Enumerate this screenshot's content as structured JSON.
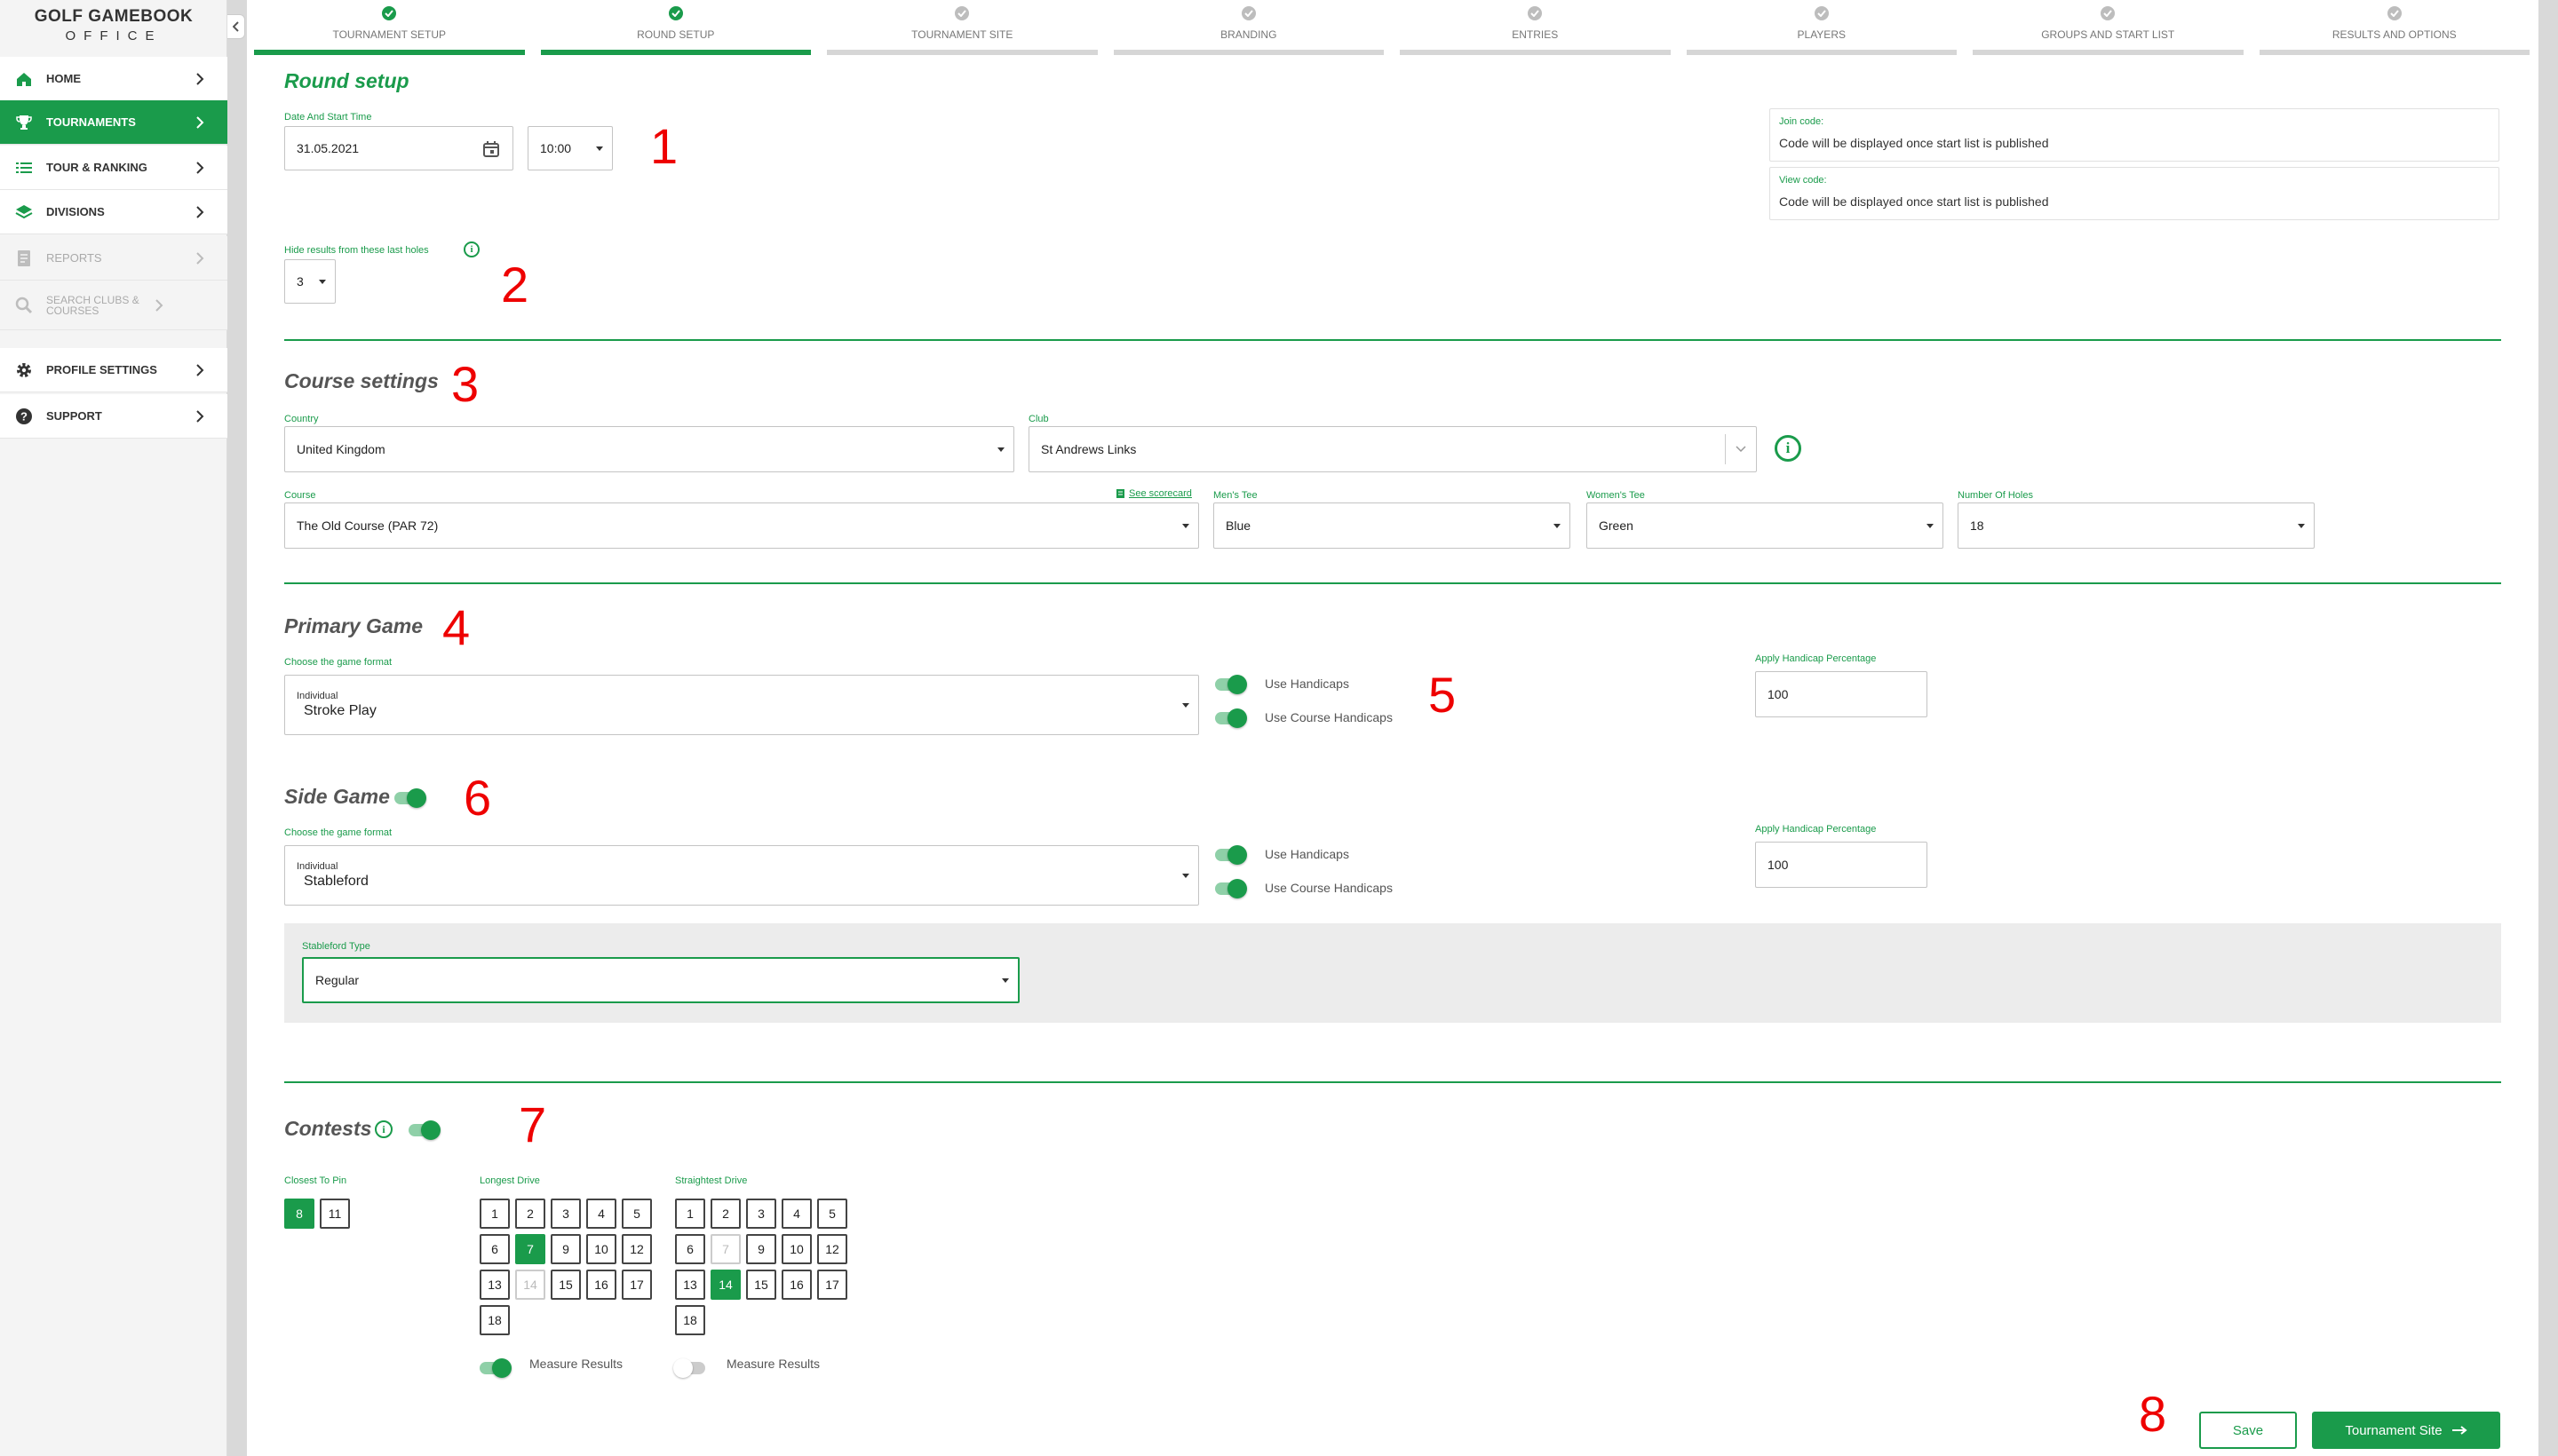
{
  "brand": {
    "logo_top": "GOLF GAMEBOOK",
    "logo_bottom": "OFFICE",
    "accent": "#1a9b4b"
  },
  "sidebar": {
    "items": [
      {
        "label": "HOME",
        "icon": "home-icon",
        "state": "normal"
      },
      {
        "label": "TOURNAMENTS",
        "icon": "trophy-icon",
        "state": "active"
      },
      {
        "label": "TOUR & RANKING",
        "icon": "list-icon",
        "state": "normal"
      },
      {
        "label": "DIVISIONS",
        "icon": "layers-icon",
        "state": "normal"
      },
      {
        "label": "REPORTS",
        "icon": "report-icon",
        "state": "disabled"
      },
      {
        "label": "SEARCH CLUBS & COURSES",
        "icon": "search-icon",
        "state": "disabled"
      },
      {
        "label": "PROFILE SETTINGS",
        "icon": "gear-icon",
        "state": "normal"
      },
      {
        "label": "SUPPORT",
        "icon": "help-icon",
        "state": "normal"
      }
    ]
  },
  "stepper": [
    {
      "label": "TOURNAMENT SETUP",
      "state": "done"
    },
    {
      "label": "ROUND SETUP",
      "state": "done"
    },
    {
      "label": "TOURNAMENT SITE",
      "state": "todo"
    },
    {
      "label": "BRANDING",
      "state": "todo"
    },
    {
      "label": "ENTRIES",
      "state": "todo"
    },
    {
      "label": "PLAYERS",
      "state": "todo"
    },
    {
      "label": "GROUPS AND START LIST",
      "state": "todo"
    },
    {
      "label": "RESULTS AND OPTIONS",
      "state": "todo"
    }
  ],
  "round": {
    "title": "Round setup",
    "date_label": "Date And Start Time",
    "date": "31.05.2021",
    "time": "10:00",
    "join_label": "Join code:",
    "join_value": "Code will be displayed once start list is published",
    "view_label": "View code:",
    "view_value": "Code will be displayed once start list is published",
    "hide_label": "Hide results from these last holes",
    "hide_value": "3"
  },
  "course": {
    "title": "Course settings",
    "country_label": "Country",
    "country": "United Kingdom",
    "club_label": "Club",
    "club": "St Andrews Links",
    "course_label": "Course",
    "course": "The Old Course (PAR 72)",
    "scorecard": "See scorecard",
    "mens_label": "Men's Tee",
    "mens": "Blue",
    "womens_label": "Women's Tee",
    "womens": "Green",
    "holes_label": "Number Of Holes",
    "holes": "18"
  },
  "primary": {
    "title": "Primary Game",
    "format_label": "Choose the game format",
    "format_type": "Individual",
    "format": "Stroke Play",
    "use_hcp": "Use Handicaps",
    "use_course_hcp": "Use Course Handicaps",
    "pct_label": "Apply Handicap Percentage",
    "pct": "100"
  },
  "side": {
    "title": "Side Game",
    "enabled": true,
    "format_label": "Choose the game format",
    "format_type": "Individual",
    "format": "Stableford",
    "use_hcp": "Use Handicaps",
    "use_course_hcp": "Use Course Handicaps",
    "pct_label": "Apply Handicap Percentage",
    "pct": "100",
    "stableford_label": "Stableford Type",
    "stableford": "Regular"
  },
  "contests": {
    "title": "Contests",
    "enabled": true,
    "closest_label": "Closest To Pin",
    "closest_holes": [
      "8",
      "11"
    ],
    "closest_selected": [
      "8"
    ],
    "longest_label": "Longest Drive",
    "longest_selected": [
      "7"
    ],
    "longest_disabled": [
      "14"
    ],
    "straightest_label": "Straightest Drive",
    "straightest_selected": [
      "14"
    ],
    "straightest_disabled": [
      "7"
    ],
    "measure_label": "Measure Results",
    "longest_measure": true,
    "straightest_measure": false
  },
  "holes": [
    "1",
    "2",
    "3",
    "4",
    "5",
    "6",
    "7",
    "9",
    "10",
    "12",
    "13",
    "14",
    "15",
    "16",
    "17",
    "18"
  ],
  "actions": {
    "save": "Save",
    "next": "Tournament Site"
  },
  "markers": [
    "1",
    "2",
    "3",
    "4",
    "5",
    "6",
    "7",
    "8"
  ]
}
